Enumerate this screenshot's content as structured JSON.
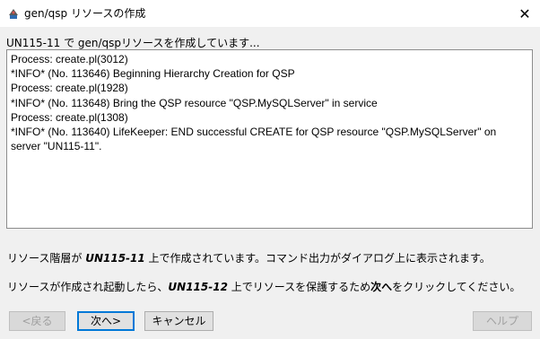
{
  "window": {
    "title": "gen/qsp リソースの作成",
    "close_glyph": "✕"
  },
  "status": {
    "line": "UN115-11 で gen/qspリソースを作成しています..."
  },
  "log": {
    "lines": [
      "Process: create.pl(3012)",
      "*INFO* (No. 113646) Beginning Hierarchy Creation for QSP",
      "Process: create.pl(1928)",
      "*INFO* (No. 113648) Bring the QSP resource \"QSP.MySQLServer\" in service",
      "Process: create.pl(1308)",
      "*INFO* (No. 113640) LifeKeeper: END successful CREATE for QSP resource \"QSP.MySQLServer\" on",
      "server \"UN115-11\"."
    ]
  },
  "info": {
    "line1": {
      "prefix": "リソース階層が ",
      "server": "UN115-11",
      "suffix": " 上で作成されています。コマンド出力がダイアログ上に表示されます。"
    },
    "line2": {
      "prefix": "リソースが作成され起動したら、",
      "server": "UN115-12",
      "middle": " 上でリソースを保護するため",
      "next": "次へ",
      "suffix": "をクリックしてください。"
    }
  },
  "buttons": {
    "back": "<戻る",
    "next": "次へ>",
    "cancel": "キャンセル",
    "help": "ヘルプ"
  },
  "icons": {
    "app": "java-app-icon",
    "close": "close-icon"
  }
}
